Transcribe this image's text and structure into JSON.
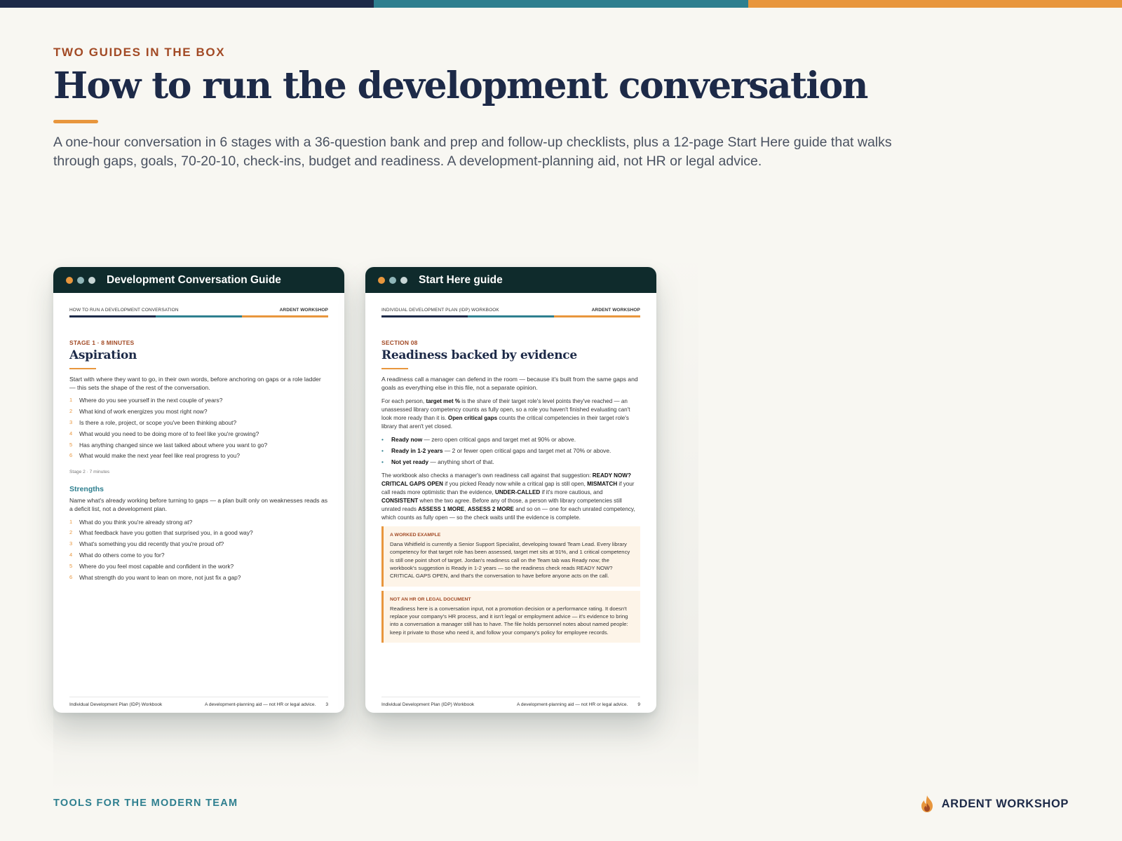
{
  "colors": {
    "navy": "#1d2a48",
    "teal": "#2e7f8f",
    "orange": "#e8963d",
    "rust": "#a24a25",
    "card_header": "#0f2b2c",
    "background": "#f8f7f2"
  },
  "header": {
    "eyebrow": "TWO GUIDES IN THE BOX",
    "title": "How to run the development conversation",
    "lede": "A one-hour conversation in 6 stages with a 36-question bank and prep and follow-up checklists, plus a 12-page Start Here guide that walks through gaps, goals, 70-20-10, check-ins, budget and readiness. A development-planning aid, not HR or legal advice."
  },
  "left_card": {
    "window_title": "Development Conversation Guide",
    "doc_header_left": "HOW TO RUN A DEVELOPMENT CONVERSATION",
    "doc_header_right": "ARDENT WORKSHOP",
    "stage_label": "STAGE 1 · 8 MINUTES",
    "section_title": "Aspiration",
    "intro": "Start with where they want to go, in their own words, before anchoring on gaps or a role ladder — this sets the shape of the rest of the conversation.",
    "questions": [
      {
        "n": "1",
        "text": "Where do you see yourself in the next couple of years?"
      },
      {
        "n": "2",
        "text": "What kind of work energizes you most right now?"
      },
      {
        "n": "3",
        "text": "Is there a role, project, or scope you've been thinking about?"
      },
      {
        "n": "4",
        "text": "What would you need to be doing more of to feel like you're growing?"
      },
      {
        "n": "5",
        "text": "Has anything changed since we last talked about where you want to go?"
      },
      {
        "n": "6",
        "text": "What would make the next year feel like real progress to you?"
      }
    ],
    "stage2_label": "Stage 2 · 7 minutes",
    "stage2_title": "Strengths",
    "stage2_intro": "Name what's already working before turning to gaps — a plan built only on weaknesses reads as a deficit list, not a development plan.",
    "stage2_questions": [
      {
        "n": "1",
        "text": "What do you think you're already strong at?"
      },
      {
        "n": "2",
        "text": "What feedback have you gotten that surprised you, in a good way?"
      },
      {
        "n": "3",
        "text": "What's something you did recently that you're proud of?"
      },
      {
        "n": "4",
        "text": "What do others come to you for?"
      },
      {
        "n": "5",
        "text": "Where do you feel most capable and confident in the work?"
      },
      {
        "n": "6",
        "text": "What strength do you want to lean on more, not just fix a gap?"
      }
    ],
    "footer_left": "Individual Development Plan (IDP) Workbook",
    "footer_mid": "A development-planning aid — not HR or legal advice.",
    "footer_page": "3"
  },
  "right_card": {
    "window_title": "Start Here guide",
    "doc_header_left": "INDIVIDUAL DEVELOPMENT PLAN (IDP) WORKBOOK",
    "doc_header_right": "ARDENT WORKSHOP",
    "section_label": "SECTION 08",
    "section_title": "Readiness backed by evidence",
    "intro": "A readiness call a manager can defend in the room — because it's built from the same gaps and goals as everything else in this file, not a separate opinion.",
    "p2": {
      "a": "For each person, ",
      "b": "target met %",
      "c": " is the share of their target role's level points they've reached — an unassessed library competency counts as fully open, so a role you haven't finished evaluating can't look more ready than it is. ",
      "d": "Open critical gaps",
      "e": " counts the critical competencies in their target role's library that aren't yet closed."
    },
    "bullets": [
      {
        "label": "Ready now",
        "text": " — zero open critical gaps and target met at 90% or above."
      },
      {
        "label": "Ready in 1-2 years",
        "text": " — 2 or fewer open critical gaps and target met at 70% or above."
      },
      {
        "label": "Not yet ready",
        "text": " — anything short of that."
      }
    ],
    "p3": {
      "a": "The workbook also checks a manager's own readiness call against that suggestion: ",
      "b": "READY NOW? CRITICAL GAPS OPEN",
      "c": " if you picked Ready now while a critical gap is still open, ",
      "d": "MISMATCH",
      "e": " if your call reads more optimistic than the evidence, ",
      "f": "UNDER-CALLED",
      "g": " if it's more cautious, and ",
      "h": "CONSISTENT",
      "i": " when the two agree. Before any of those, a person with library competencies still unrated reads ",
      "j": "ASSESS 1 MORE",
      "k": ", ",
      "l": "ASSESS 2 MORE",
      "m": " and so on — one for each unrated competency, which counts as fully open — so the check waits until the evidence is complete."
    },
    "callout1_label": "A WORKED EXAMPLE",
    "callout1_body": "Dana Whitfield is currently a Senior Support Specialist, developing toward Team Lead. Every library competency for that target role has been assessed, target met sits at 91%, and 1 critical competency is still one point short of target. Jordan's readiness call on the Team tab was Ready now; the workbook's suggestion is Ready in 1-2 years — so the readiness check reads READY NOW? CRITICAL GAPS OPEN, and that's the conversation to have before anyone acts on the call.",
    "callout2_label": "NOT AN HR OR LEGAL DOCUMENT",
    "callout2_body": "Readiness here is a conversation input, not a promotion decision or a performance rating. It doesn't replace your company's HR process, and it isn't legal or employment advice — it's evidence to bring into a conversation a manager still has to have. The file holds personnel notes about named people: keep it private to those who need it, and follow your company's policy for employee records.",
    "footer_left": "Individual Development Plan (IDP) Workbook",
    "footer_mid": "A development-planning aid — not HR or legal advice.",
    "footer_page": "9"
  },
  "footer": {
    "tagline": "TOOLS FOR THE MODERN TEAM",
    "brand": "ARDENT WORKSHOP",
    "brand_icon": "flame-logo-icon"
  }
}
